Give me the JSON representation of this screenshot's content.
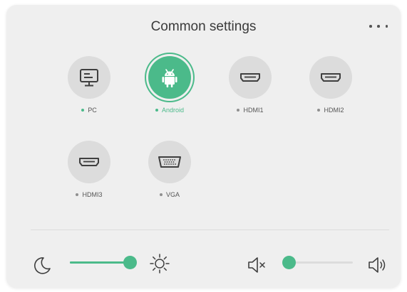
{
  "panel": {
    "title": "Common settings",
    "menu_icon": "more-horizontal-icon"
  },
  "sources": [
    {
      "label": "PC",
      "icon": "monitor-icon",
      "state": "available"
    },
    {
      "label": "Android",
      "icon": "android-icon",
      "state": "selected"
    },
    {
      "label": "HDMI1",
      "icon": "hdmi-port-icon",
      "state": "unavailable"
    },
    {
      "label": "HDMI2",
      "icon": "hdmi-port-icon",
      "state": "unavailable"
    },
    {
      "label": "HDMI3",
      "icon": "hdmi-port-icon",
      "state": "unavailable"
    },
    {
      "label": "VGA",
      "icon": "vga-port-icon",
      "state": "unavailable"
    }
  ],
  "brightness": {
    "min_icon": "moon-icon",
    "max_icon": "sun-icon",
    "level": 1.0
  },
  "volume": {
    "min_icon": "speaker-mute-icon",
    "max_icon": "speaker-loud-icon",
    "level": 0.0
  },
  "colors": {
    "accent": "#4bba8a",
    "panel_background": "#efefef",
    "icon_circle": "#dcdcdc",
    "icon_stroke": "#3f3f3f"
  }
}
